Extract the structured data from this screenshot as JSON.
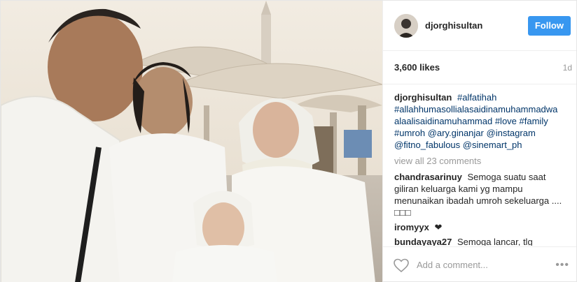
{
  "header": {
    "username": "djorghisultan",
    "follow_label": "Follow"
  },
  "stats": {
    "likes": "3,600 likes",
    "time_ago": "1d"
  },
  "caption": {
    "user": "djorghisultan",
    "parts": [
      "#alfatihah",
      "#allahhumasollialasaidinamuhammadwa alaalisaidinamuhammad",
      "#love",
      "#family",
      "#umroh",
      "@ary.ginanjar",
      "@instagram",
      "@fitno_fabulous",
      "@sinemart_ph"
    ]
  },
  "view_all": "view all 23 comments",
  "comments": [
    {
      "user": "chandrasarinuy",
      "text": "Semoga suatu saat giliran keluarga kami yg mampu menunaikan ibadah umroh sekeluarga .... □□□"
    },
    {
      "user": "iromyyx",
      "text": "❤"
    },
    {
      "user": "bundayaya27",
      "text": "Semoga lancar, tlg"
    }
  ],
  "footer": {
    "add_comment_placeholder": "Add a comment...",
    "more_label": "•••"
  },
  "icons": {
    "like": "heart-icon",
    "more": "more-options-icon"
  },
  "colors": {
    "follow_button": "#3897f0",
    "hashtag": "#003569",
    "muted": "#999999"
  }
}
